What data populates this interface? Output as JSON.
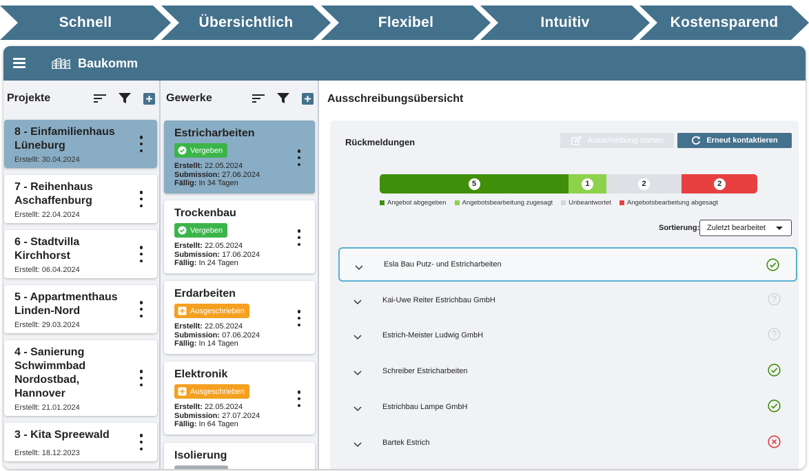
{
  "banner": [
    "Schnell",
    "Übersichtlich",
    "Flexibel",
    "Intuitiv",
    "Kostensparend"
  ],
  "app": {
    "brand": "Baukomm"
  },
  "projects": {
    "title": "Projekte",
    "items": [
      {
        "title": "8 - Einfamilienhaus Lüneburg",
        "date": "Erstellt: 30.04.2024",
        "selected": true
      },
      {
        "title": "7 - Reihenhaus Aschaffenburg",
        "date": "Erstellt: 22.04.2024"
      },
      {
        "title": "6 - Stadtvilla Kirchhorst",
        "date": "Erstellt: 06.04.2024"
      },
      {
        "title": "5 - Appartmenthaus Linden-Nord",
        "date": "Erstellt: 29.03.2024"
      },
      {
        "title": "4 - Sanierung Schwimmbad Nordostbad, Hannover",
        "date": "Erstellt: 21.01.2024"
      },
      {
        "title": "3 - Kita Spreewald",
        "date": "Erstellt: 18.12.2023"
      }
    ]
  },
  "trades": {
    "title": "Gewerke",
    "labels": {
      "created": "Erstellt:",
      "submission": "Submission:",
      "due": "Fällig:"
    },
    "items": [
      {
        "title": "Estricharbeiten",
        "status": "Vergeben",
        "created": "22.05.2024",
        "submission": "27.06.2024",
        "due": "In 34 Tagen",
        "selected": true
      },
      {
        "title": "Trockenbau",
        "status": "Vergeben",
        "created": "22.05.2024",
        "submission": "17.06.2024",
        "due": "In 24 Tagen"
      },
      {
        "title": "Erdarbeiten",
        "status": "Ausgeschrieben",
        "created": "22.05.2024",
        "submission": "07.06.2024",
        "due": "In 14 Tagen"
      },
      {
        "title": "Elektronik",
        "status": "Ausgeschrieben",
        "created": "22.05.2024",
        "submission": "27.07.2024",
        "due": "In 64 Tagen"
      },
      {
        "title": "Isolierung"
      }
    ]
  },
  "main": {
    "title": "Ausschreibungsübersicht",
    "panel_title": "Rückmeldungen",
    "btn_start": "Ausschreibung starten",
    "btn_contact": "Erneut kontaktieren",
    "summary": [
      {
        "label": "Angebot abgegeben",
        "count": 5,
        "color": "#3f8f0a"
      },
      {
        "label": "Angebotsbearbeitung zugesagt",
        "count": 1,
        "color": "#8ed14c"
      },
      {
        "label": "Unbeantwortet",
        "count": 2,
        "color": "#dde1e6"
      },
      {
        "label": "Angebotsbearbeitung abgesagt",
        "count": 2,
        "color": "#e84040"
      }
    ],
    "sort_label": "Sortierung:",
    "sort_value": "Zuletzt bearbeitet",
    "responses": [
      {
        "name": "Esla Bau Putz- und Estricharbeiten",
        "status": "accepted",
        "highlighted": true
      },
      {
        "name": "Kai-Uwe Reiter Estrichbau GmbH",
        "status": "unknown"
      },
      {
        "name": "Estrich-Meister Ludwig GmbH",
        "status": "unknown"
      },
      {
        "name": "Schreiber Estricharbeiten",
        "status": "accepted"
      },
      {
        "name": "Estrichbau Lampe GmbH",
        "status": "accepted"
      },
      {
        "name": "Bartek Estrich",
        "status": "declined"
      }
    ]
  },
  "colors": {
    "primary": "#44718c",
    "selected": "#89adc4",
    "green": "#3bb54a",
    "orange": "#f5a020"
  }
}
